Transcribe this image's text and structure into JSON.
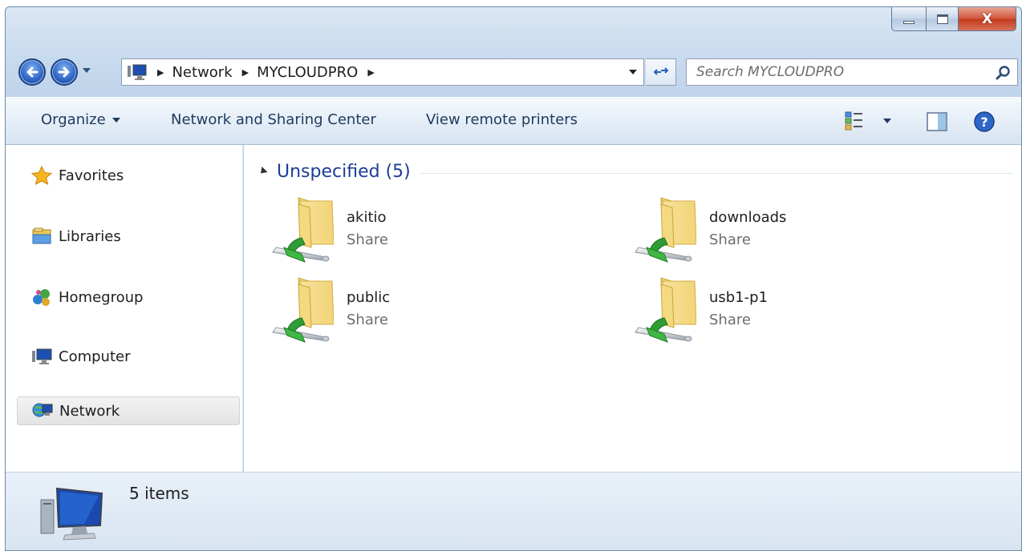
{
  "toolbar": {
    "breadcrumb": [
      "Network",
      "MYCLOUDPRO"
    ],
    "search_placeholder": "Search MYCLOUDPRO"
  },
  "commands": {
    "organize": "Organize",
    "network_sharing": "Network and Sharing Center",
    "view_remote_printers": "View remote printers"
  },
  "sidebar": {
    "items": [
      {
        "label": "Favorites",
        "icon": "star-icon"
      },
      {
        "label": "Libraries",
        "icon": "libraries-icon"
      },
      {
        "label": "Homegroup",
        "icon": "homegroup-icon"
      },
      {
        "label": "Computer",
        "icon": "computer-icon"
      },
      {
        "label": "Network",
        "icon": "network-icon",
        "selected": true
      }
    ]
  },
  "content": {
    "group_title": "Unspecified (5)",
    "items": [
      {
        "name": "akitio",
        "type": "Share"
      },
      {
        "name": "downloads",
        "type": "Share"
      },
      {
        "name": "public",
        "type": "Share"
      },
      {
        "name": "usb1-p1",
        "type": "Share"
      }
    ]
  },
  "details": {
    "count": "5 items"
  }
}
